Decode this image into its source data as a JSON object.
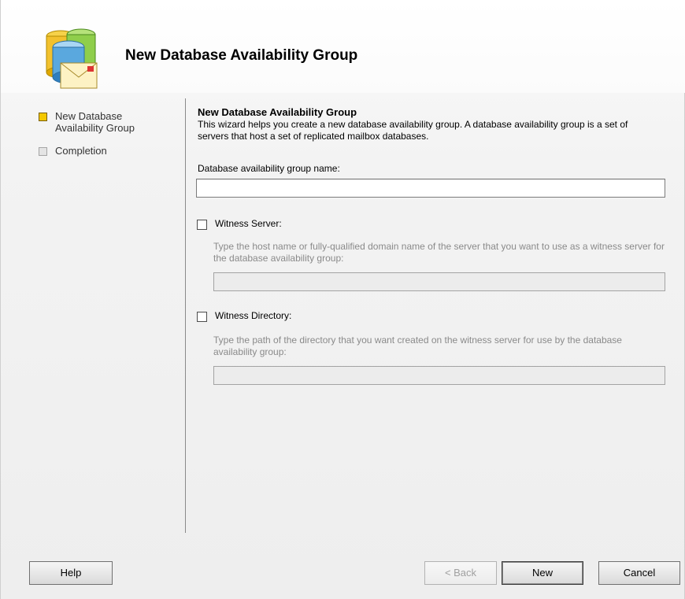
{
  "dialog": {
    "title": "New Database Availability Group",
    "logo_icon": "database-mail-icon"
  },
  "steps": [
    {
      "label": "New Database Availability Group",
      "state": "active"
    },
    {
      "label": "Completion",
      "state": "inactive"
    }
  ],
  "content": {
    "title": "New Database Availability Group",
    "description": "This wizard helps you create a new database availability group. A database availability group is a set of servers that host a set of replicated mailbox databases.",
    "name_label": "Database availability group name:",
    "name_value": "",
    "witness_server": {
      "label": "Witness Server:",
      "checked": false,
      "hint": "Type the host name or fully-qualified domain name of the server that you want to use as a witness server for the database availability group:",
      "value": ""
    },
    "witness_directory": {
      "label": "Witness Directory:",
      "checked": false,
      "hint": "Type the path of the directory that you want created on the witness server for use by the database availability group:",
      "value": ""
    }
  },
  "buttons": {
    "help": "Help",
    "back": "< Back",
    "new": "New",
    "cancel": "Cancel"
  },
  "colors": {
    "active_step": "#f4c800",
    "inactive_step": "#e4e4e4"
  }
}
